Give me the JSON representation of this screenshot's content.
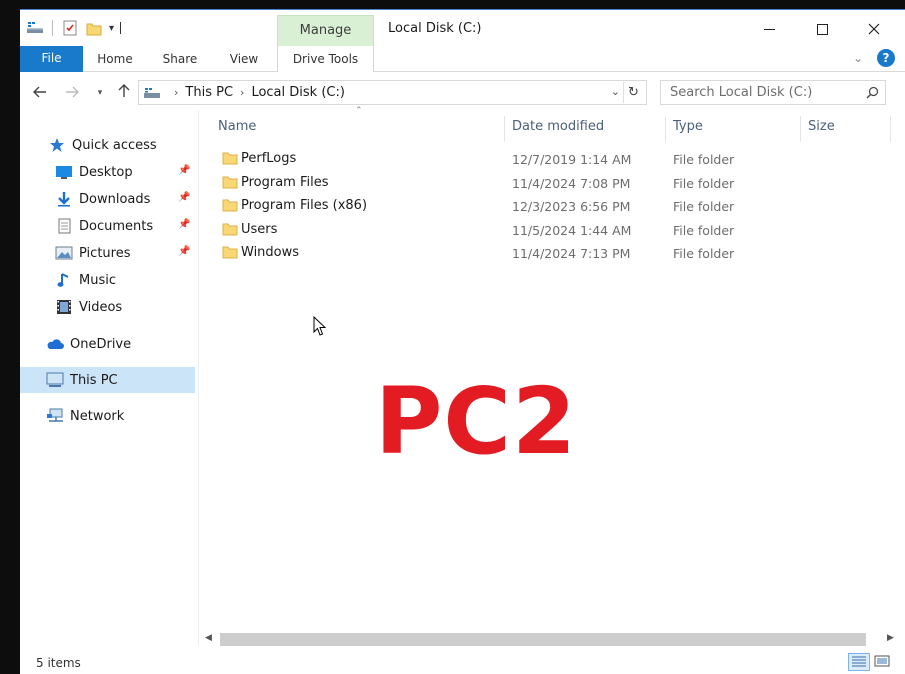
{
  "window": {
    "title": "Local Disk (C:)",
    "manage_tab": "Manage",
    "minimize_icon": "minimize-icon",
    "maximize_icon": "maximize-icon",
    "close_icon": "close-icon"
  },
  "ribbon": {
    "tabs": [
      "File",
      "Home",
      "Share",
      "View",
      "Drive Tools"
    ],
    "help_label": "?"
  },
  "address": {
    "crumbs": [
      "This PC",
      "Local Disk (C:)"
    ],
    "search_placeholder": "Search Local Disk (C:)"
  },
  "nav": {
    "items": [
      {
        "label": "Quick access",
        "icon": "star-icon",
        "pinned": false
      },
      {
        "label": "Desktop",
        "icon": "desktop-icon",
        "pinned": true
      },
      {
        "label": "Downloads",
        "icon": "download-icon",
        "pinned": true
      },
      {
        "label": "Documents",
        "icon": "documents-icon",
        "pinned": true
      },
      {
        "label": "Pictures",
        "icon": "pictures-icon",
        "pinned": true
      },
      {
        "label": "Music",
        "icon": "music-icon",
        "pinned": false
      },
      {
        "label": "Videos",
        "icon": "videos-icon",
        "pinned": false
      },
      {
        "label": "OneDrive",
        "icon": "cloud-icon",
        "pinned": false
      },
      {
        "label": "This PC",
        "icon": "computer-icon",
        "pinned": false,
        "selected": true
      },
      {
        "label": "Network",
        "icon": "network-icon",
        "pinned": false
      }
    ]
  },
  "list": {
    "columns": [
      "Name",
      "Date modified",
      "Type",
      "Size"
    ],
    "rows": [
      {
        "name": "PerfLogs",
        "date": "12/7/2019 1:14 AM",
        "type": "File folder"
      },
      {
        "name": "Program Files",
        "date": "11/4/2024 7:08 PM",
        "type": "File folder"
      },
      {
        "name": "Program Files (x86)",
        "date": "12/3/2023 6:56 PM",
        "type": "File folder"
      },
      {
        "name": "Users",
        "date": "11/5/2024 1:44 AM",
        "type": "File folder"
      },
      {
        "name": "Windows",
        "date": "11/4/2024 7:13 PM",
        "type": "File folder"
      }
    ]
  },
  "overlay": {
    "text": "PC2",
    "color": "#e31b23"
  },
  "status": {
    "count": "5 items"
  },
  "colors": {
    "accent": "#1979ca",
    "manage_tab": "#d9f0d4",
    "selected": "#cce4f7",
    "folder": "#f8d775"
  }
}
